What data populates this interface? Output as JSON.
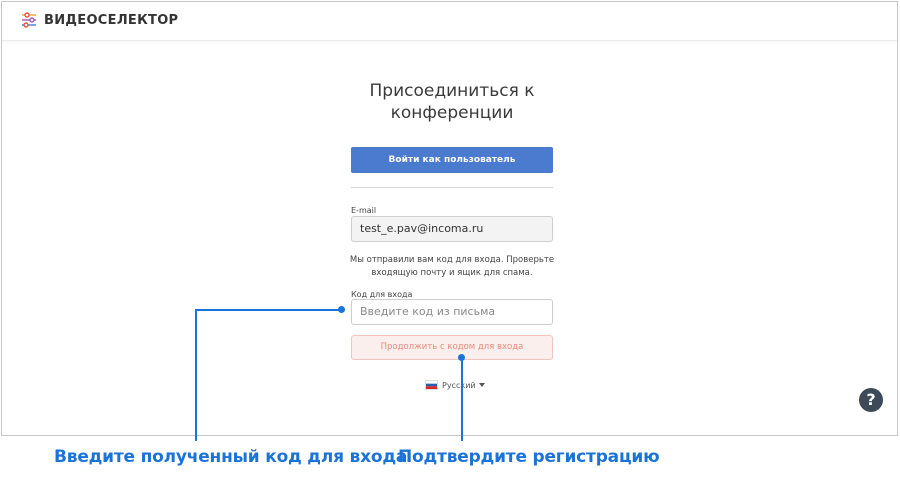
{
  "app": {
    "brand": "ВИДЕОСЕЛЕКТОР",
    "logo_icon": "sliders-logo-icon"
  },
  "join": {
    "title": "Присоединиться к конференции",
    "login_user_label": "Войти как пользователь",
    "email_label": "E-mail",
    "email_value": "test_e.pav@incoma.ru",
    "code_sent_note": "Мы отправили вам код для входа. Проверьте входящую почту и ящик для спама.",
    "code_label": "Код для входа",
    "code_placeholder": "Введите код из письма",
    "continue_label": "Продолжить с кодом для входа",
    "language": "Русский",
    "language_flag_icon": "russia-flag-icon"
  },
  "help": {
    "label": "?",
    "icon": "help-circle-icon"
  },
  "annotations": {
    "enter_code": "Введите полученный код для входа",
    "confirm": "Подтвердите регистрацию",
    "color": "#1a73d8"
  },
  "colors": {
    "primary": "#4b7bce",
    "secondary_bg": "#fbefed",
    "secondary_text": "#e58c7b",
    "help_bg": "#3d4a57"
  }
}
